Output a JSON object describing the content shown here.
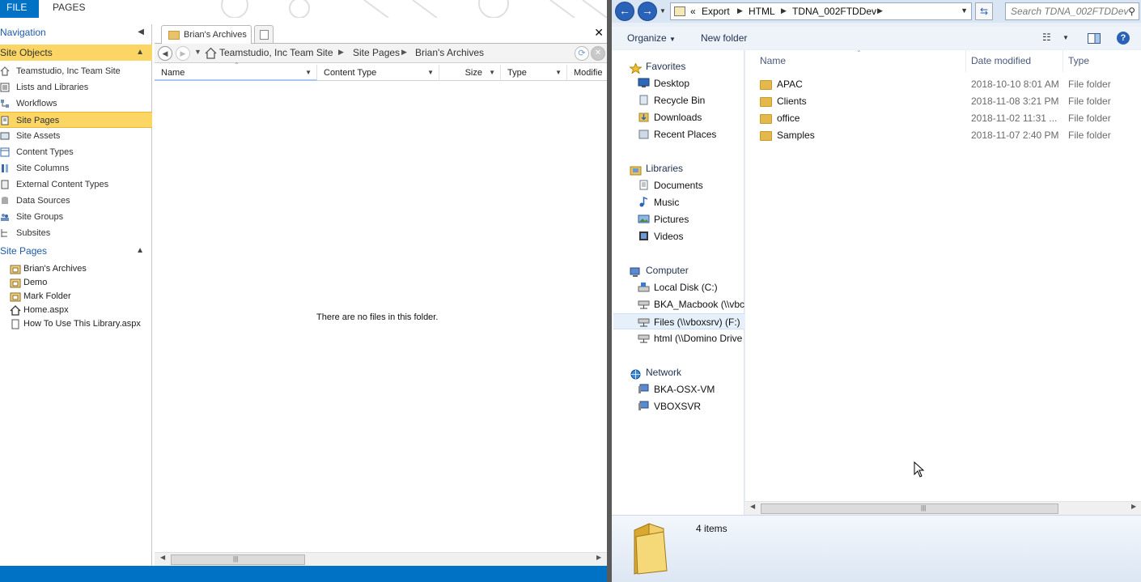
{
  "ribbon": {
    "file_label": "FILE",
    "pages_label": "PAGES"
  },
  "nav": {
    "header_navigation": "Navigation",
    "header_site_objects": "Site Objects",
    "site_objects": [
      {
        "label": "Teamstudio, Inc Team Site",
        "icon": "home-icon"
      },
      {
        "label": "Lists and Libraries",
        "icon": "list-icon"
      },
      {
        "label": "Workflows",
        "icon": "workflow-icon"
      },
      {
        "label": "Site Pages",
        "icon": "pages-icon",
        "selected": true
      },
      {
        "label": "Site Assets",
        "icon": "assets-icon"
      },
      {
        "label": "Content Types",
        "icon": "content-types-icon"
      },
      {
        "label": "Site Columns",
        "icon": "columns-icon"
      },
      {
        "label": "External Content Types",
        "icon": "external-content-icon"
      },
      {
        "label": "Data Sources",
        "icon": "database-icon"
      },
      {
        "label": "Site Groups",
        "icon": "groups-icon"
      },
      {
        "label": "Subsites",
        "icon": "subsites-icon"
      }
    ],
    "header_site_pages": "Site Pages",
    "site_pages": [
      {
        "label": "Brian's Archives",
        "icon": "folder-icon"
      },
      {
        "label": "Demo",
        "icon": "folder-icon"
      },
      {
        "label": "Mark Folder",
        "icon": "folder-icon"
      },
      {
        "label": "Home.aspx",
        "icon": "home-page-icon"
      },
      {
        "label": "How To Use This Library.aspx",
        "icon": "page-icon"
      }
    ]
  },
  "doc": {
    "tab_label": "Brian's Archives",
    "breadcrumb": [
      "Teamstudio, Inc Team Site",
      "Site Pages",
      "Brian's Archives"
    ],
    "columns": [
      "Name",
      "Content Type",
      "Size",
      "Type",
      "Modifie"
    ],
    "empty_message": "There are no files in this folder."
  },
  "explorer": {
    "address": [
      "«",
      "Export",
      "HTML",
      "TDNA_002FTDDev"
    ],
    "search_placeholder": "Search TDNA_002FTDDev",
    "toolbar": {
      "organize": "Organize",
      "new_folder": "New folder"
    },
    "tree": {
      "favorites": "Favorites",
      "favorites_items": [
        "Desktop",
        "Recycle Bin",
        "Downloads",
        "Recent Places"
      ],
      "libraries": "Libraries",
      "libraries_items": [
        "Documents",
        "Music",
        "Pictures",
        "Videos"
      ],
      "computer": "Computer",
      "computer_items": [
        "Local Disk (C:)",
        "BKA_Macbook (\\\\vbc",
        "Files (\\\\vboxsrv) (F:)",
        "html (\\\\Domino Drive"
      ],
      "network": "Network",
      "network_items": [
        "BKA-OSX-VM",
        "VBOXSVR"
      ]
    },
    "columns": {
      "name": "Name",
      "date": "Date modified",
      "type": "Type"
    },
    "files": [
      {
        "name": "APAC",
        "date": "2018-10-10 8:01 AM",
        "type": "File folder"
      },
      {
        "name": "Clients",
        "date": "2018-11-08 3:21 PM",
        "type": "File folder"
      },
      {
        "name": "office",
        "date": "2018-11-02 11:31 ...",
        "type": "File folder"
      },
      {
        "name": "Samples",
        "date": "2018-11-07 2:40 PM",
        "type": "File folder"
      }
    ],
    "item_count": "4 items"
  },
  "colors": {
    "accent": "#0072c6",
    "selection": "#fcd665",
    "explorer_bg": "#e9eff7"
  }
}
